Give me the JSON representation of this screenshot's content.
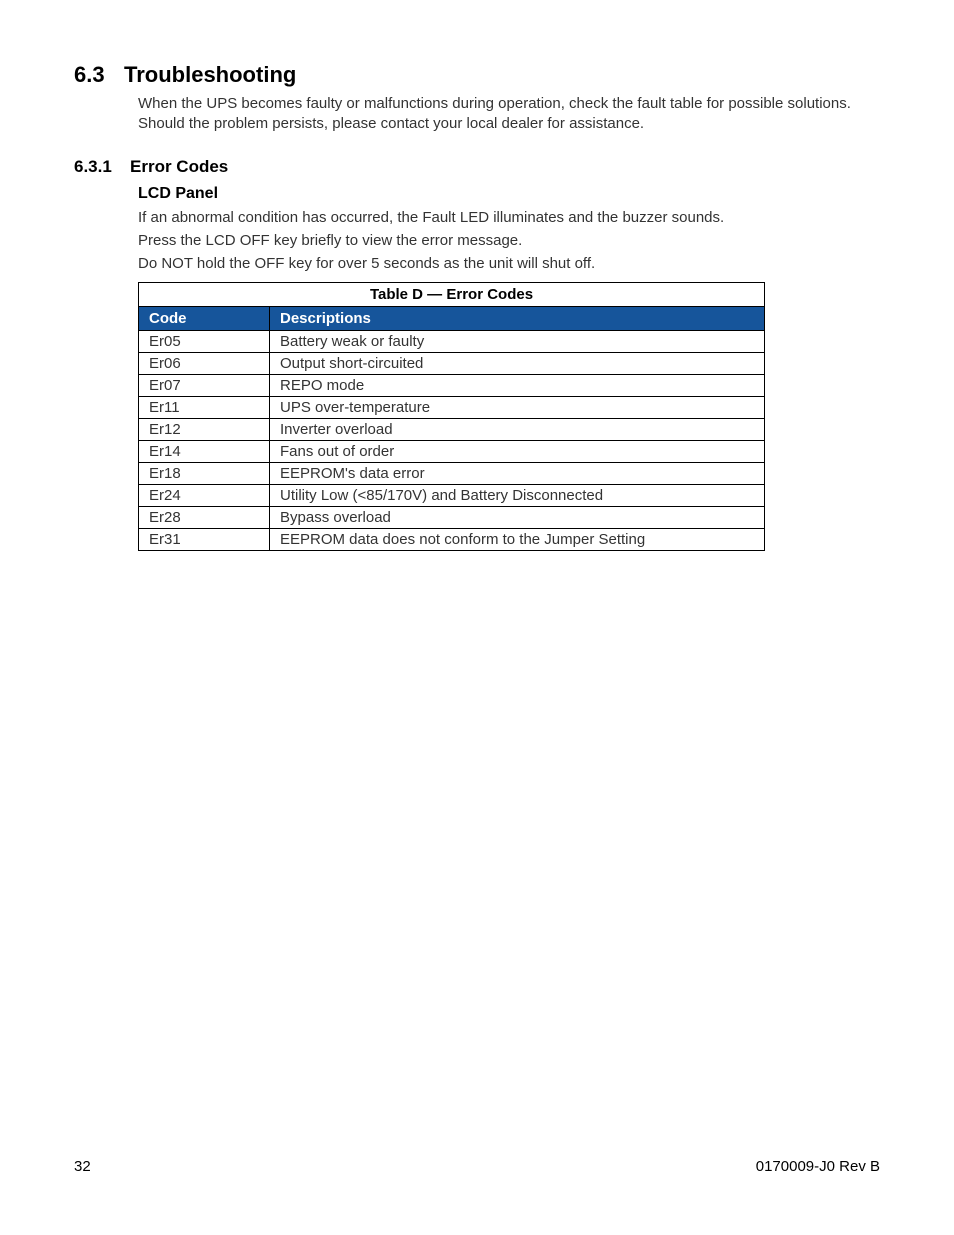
{
  "section": {
    "number": "6.3",
    "title": "Troubleshooting",
    "intro": "When the UPS becomes faulty or malfunctions during operation, check the fault table for possible solutions. Should the problem persists, please contact your local dealer for assistance."
  },
  "subsection": {
    "number": "6.3.1",
    "title": "Error Codes",
    "sub_title": "LCD Panel",
    "line1": "If an abnormal condition has occurred, the Fault LED illuminates and the buzzer sounds.",
    "line2": "Press the LCD OFF key briefly to view the error message.",
    "line3": "Do NOT hold the OFF key for over 5 seconds as the unit will shut off."
  },
  "table": {
    "caption": "Table D  —  Error Codes",
    "head_code": "Code",
    "head_desc": "Descriptions",
    "rows": [
      {
        "code": "Er05",
        "desc": "Battery weak or faulty"
      },
      {
        "code": "Er06",
        "desc": "Output short-circuited"
      },
      {
        "code": "Er07",
        "desc": "REPO mode"
      },
      {
        "code": "Er11",
        "desc": "UPS over-temperature"
      },
      {
        "code": "Er12",
        "desc": "Inverter overload"
      },
      {
        "code": "Er14",
        "desc": "Fans out of order"
      },
      {
        "code": "Er18",
        "desc": "EEPROM's data error"
      },
      {
        "code": "Er24",
        "desc": "Utility Low (<85/170V) and Battery Disconnected"
      },
      {
        "code": "Er28",
        "desc": "Bypass overload"
      },
      {
        "code": "Er31",
        "desc": "EEPROM data does not conform to the Jumper Setting"
      }
    ]
  },
  "footer": {
    "page": "32",
    "docid": "0170009-J0   Rev B"
  }
}
